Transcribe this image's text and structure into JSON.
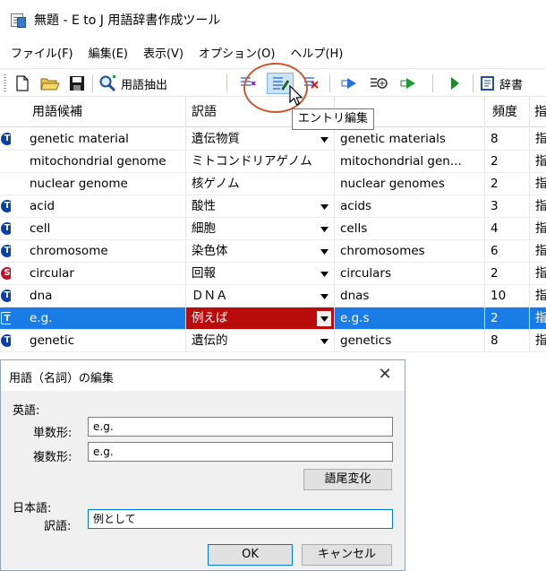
{
  "window": {
    "title": "無題 - E to J 用語辞書作成ツール"
  },
  "menu": [
    "ファイル(F)",
    "編集(E)",
    "表示(V)",
    "オプション(O)",
    "ヘルプ(H)"
  ],
  "toolbar": {
    "extract_label": "用語抽出",
    "dict_label": "辞書"
  },
  "tooltip": "エントリ編集",
  "grid": {
    "columns": [
      "用語候補",
      "訳語",
      "",
      "頻度",
      "指"
    ],
    "rows": [
      {
        "badge": "T",
        "term": "genetic material",
        "translation": "遺伝物質",
        "plural": "genetic materials",
        "freq": "8",
        "extra": "指",
        "dropdown": true,
        "selected": false
      },
      {
        "badge": "",
        "term": "mitochondrial genome",
        "translation": "ミトコンドリアゲノム",
        "plural": "mitochondrial gen...",
        "freq": "2",
        "extra": "指",
        "dropdown": false,
        "selected": false
      },
      {
        "badge": "",
        "term": "nuclear genome",
        "translation": "核ゲノム",
        "plural": "nuclear genomes",
        "freq": "2",
        "extra": "指",
        "dropdown": false,
        "selected": false
      },
      {
        "badge": "T",
        "term": "acid",
        "translation": "酸性",
        "plural": "acids",
        "freq": "3",
        "extra": "指",
        "dropdown": true,
        "selected": false
      },
      {
        "badge": "T",
        "term": "cell",
        "translation": "細胞",
        "plural": "cells",
        "freq": "4",
        "extra": "指",
        "dropdown": true,
        "selected": false
      },
      {
        "badge": "T",
        "term": "chromosome",
        "translation": "染色体",
        "plural": "chromosomes",
        "freq": "6",
        "extra": "指",
        "dropdown": true,
        "selected": false
      },
      {
        "badge": "S",
        "term": "circular",
        "translation": "回報",
        "plural": "circulars",
        "freq": "2",
        "extra": "指",
        "dropdown": true,
        "selected": false
      },
      {
        "badge": "T",
        "term": "dna",
        "translation": "ＤＮＡ",
        "plural": "dnas",
        "freq": "10",
        "extra": "指",
        "dropdown": true,
        "selected": false
      },
      {
        "badge": "T",
        "term": "e.g.",
        "translation": "例えば",
        "plural": "e.g.s",
        "freq": "2",
        "extra": "指",
        "dropdown": true,
        "selected": true
      },
      {
        "badge": "T",
        "term": "genetic",
        "translation": "遺伝的",
        "plural": "genetics",
        "freq": "8",
        "extra": "指",
        "dropdown": true,
        "selected": false
      }
    ]
  },
  "dialog": {
    "title": "用語（名詞）の編集",
    "english_heading": "英語:",
    "singular_label": "単数形:",
    "singular_value": "e.g.",
    "plural_label": "複数形:",
    "plural_value": "e.g.",
    "inflection_button": "語尾変化",
    "japanese_heading": "日本語:",
    "translation_label": "訳語:",
    "translation_value": "例として",
    "ok_button": "OK",
    "cancel_button": "キャンセル"
  },
  "colors": {
    "badge_t": "#0a3fa8",
    "badge_s": "#c0102a",
    "selection": "#1a7ce6",
    "selection_translation": "#bb0c0c",
    "highlight_ring": "#c9582e"
  }
}
